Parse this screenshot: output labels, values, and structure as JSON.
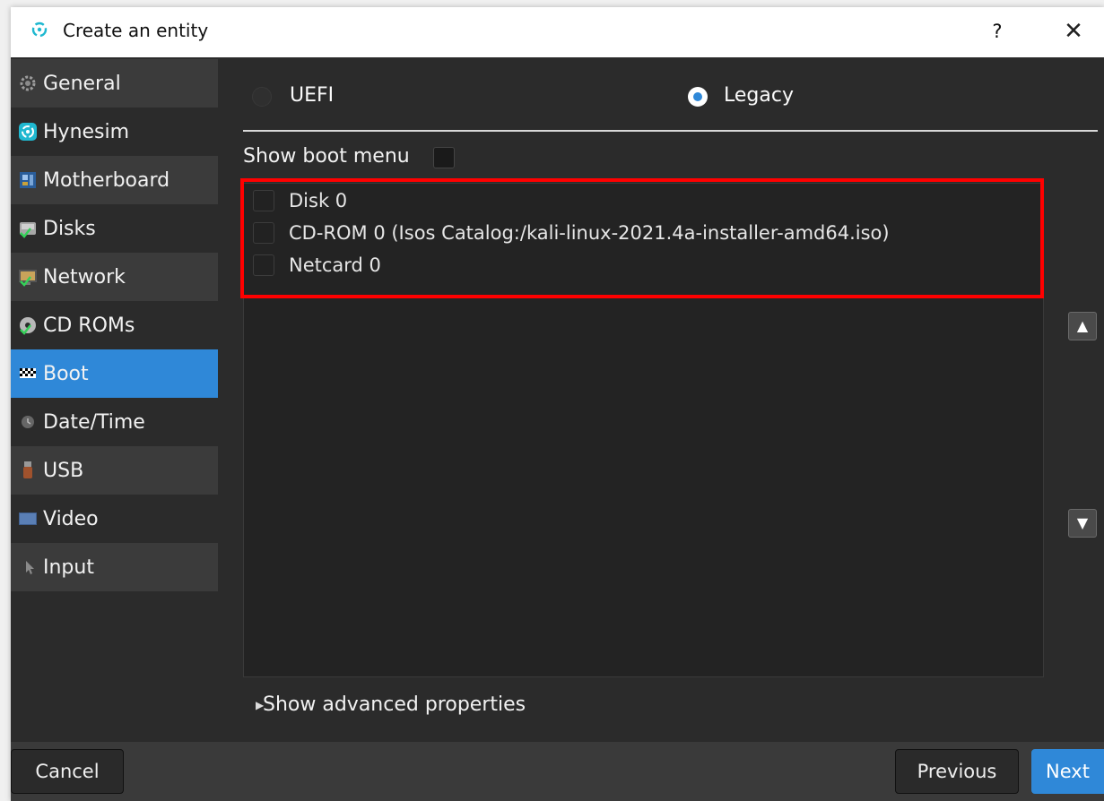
{
  "window": {
    "title": "Create an entity",
    "help_label": "?",
    "close_label": "✕"
  },
  "sidebar": {
    "items": [
      {
        "label": "General",
        "icon": "gear-icon"
      },
      {
        "label": "Hynesim",
        "icon": "hynesim-logo-icon"
      },
      {
        "label": "Motherboard",
        "icon": "motherboard-icon"
      },
      {
        "label": "Disks",
        "icon": "disk-icon"
      },
      {
        "label": "Network",
        "icon": "network-icon"
      },
      {
        "label": "CD ROMs",
        "icon": "cdrom-icon"
      },
      {
        "label": "Boot",
        "icon": "checkered-flag-icon",
        "active": true
      },
      {
        "label": "Date/Time",
        "icon": "clock-icon"
      },
      {
        "label": "USB",
        "icon": "usb-icon"
      },
      {
        "label": "Video",
        "icon": "monitor-icon"
      },
      {
        "label": "Input",
        "icon": "cursor-icon"
      }
    ]
  },
  "boot": {
    "mode_options": [
      {
        "label": "UEFI",
        "selected": false
      },
      {
        "label": "Legacy",
        "selected": true
      }
    ],
    "show_boot_menu_label": "Show boot menu",
    "show_boot_menu_checked": false,
    "devices": [
      {
        "label": "Disk 0",
        "checked": false
      },
      {
        "label": "CD-ROM 0 (Isos Catalog:/kali-linux-2021.4a-installer-amd64.iso)",
        "checked": false
      },
      {
        "label": "Netcard 0",
        "checked": false
      }
    ],
    "move_up_icon": "▲",
    "move_down_icon": "▼",
    "advanced_label": "Show advanced properties",
    "advanced_icon": "▶"
  },
  "footer": {
    "cancel_label": "Cancel",
    "previous_label": "Previous",
    "next_label": "Next"
  },
  "colors": {
    "accent": "#2f88d8",
    "highlight": "#ff0000",
    "background": "#2b2b2b"
  }
}
